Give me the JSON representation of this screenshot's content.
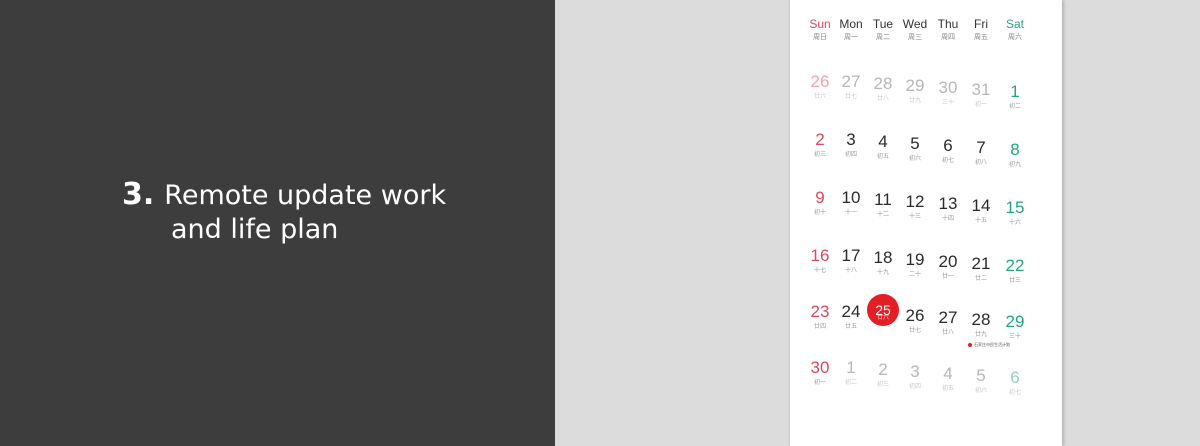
{
  "headline": {
    "number": "3.",
    "line1": "Remote update work",
    "line2": "and life plan"
  },
  "calendar": {
    "weekdays": [
      {
        "en": "Sun",
        "cn": "周日"
      },
      {
        "en": "Mon",
        "cn": "周一"
      },
      {
        "en": "Tue",
        "cn": "周二"
      },
      {
        "en": "Wed",
        "cn": "周三"
      },
      {
        "en": "Thu",
        "cn": "周四"
      },
      {
        "en": "Fri",
        "cn": "周五"
      },
      {
        "en": "Sat",
        "cn": "周六"
      }
    ],
    "rows": [
      [
        {
          "n": "26",
          "s": "廿六",
          "m": true
        },
        {
          "n": "27",
          "s": "廿七",
          "m": true
        },
        {
          "n": "28",
          "s": "廿八",
          "m": true
        },
        {
          "n": "29",
          "s": "廿九",
          "m": true
        },
        {
          "n": "30",
          "s": "三十",
          "m": true
        },
        {
          "n": "31",
          "s": "初一",
          "m": true
        },
        {
          "n": "1",
          "s": "初二"
        }
      ],
      [
        {
          "n": "2",
          "s": "初三"
        },
        {
          "n": "3",
          "s": "初四"
        },
        {
          "n": "4",
          "s": "初五"
        },
        {
          "n": "5",
          "s": "初六"
        },
        {
          "n": "6",
          "s": "初七"
        },
        {
          "n": "7",
          "s": "初八"
        },
        {
          "n": "8",
          "s": "初九"
        }
      ],
      [
        {
          "n": "9",
          "s": "初十"
        },
        {
          "n": "10",
          "s": "十一"
        },
        {
          "n": "11",
          "s": "十二"
        },
        {
          "n": "12",
          "s": "十三"
        },
        {
          "n": "13",
          "s": "十四"
        },
        {
          "n": "14",
          "s": "十五"
        },
        {
          "n": "15",
          "s": "十六"
        }
      ],
      [
        {
          "n": "16",
          "s": "十七"
        },
        {
          "n": "17",
          "s": "十八"
        },
        {
          "n": "18",
          "s": "十九"
        },
        {
          "n": "19",
          "s": "二十"
        },
        {
          "n": "20",
          "s": "廿一"
        },
        {
          "n": "21",
          "s": "廿二"
        },
        {
          "n": "22",
          "s": "廿三"
        }
      ],
      [
        {
          "n": "23",
          "s": "廿四"
        },
        {
          "n": "24",
          "s": "廿五"
        },
        {
          "n": "25",
          "s": "廿六",
          "today": true
        },
        {
          "n": "26",
          "s": "廿七"
        },
        {
          "n": "27",
          "s": "廿八"
        },
        {
          "n": "28",
          "s": "廿九"
        },
        {
          "n": "29",
          "s": "三十"
        }
      ],
      [
        {
          "n": "30",
          "s": "初一"
        },
        {
          "n": "1",
          "s": "初二",
          "m": true
        },
        {
          "n": "2",
          "s": "初三",
          "m": true
        },
        {
          "n": "3",
          "s": "初四",
          "m": true
        },
        {
          "n": "4",
          "s": "初五",
          "m": true
        },
        {
          "n": "5",
          "s": "初六",
          "m": true
        },
        {
          "n": "6",
          "s": "初七",
          "m": true
        }
      ]
    ],
    "event_note": "石家庄市民生活计划"
  },
  "colors": {
    "left_bg": "#3d3d3d",
    "right_bg": "#dcdcdc",
    "today": "#e31e24",
    "sunday": "#e0475e",
    "saturday": "#24a57f"
  }
}
